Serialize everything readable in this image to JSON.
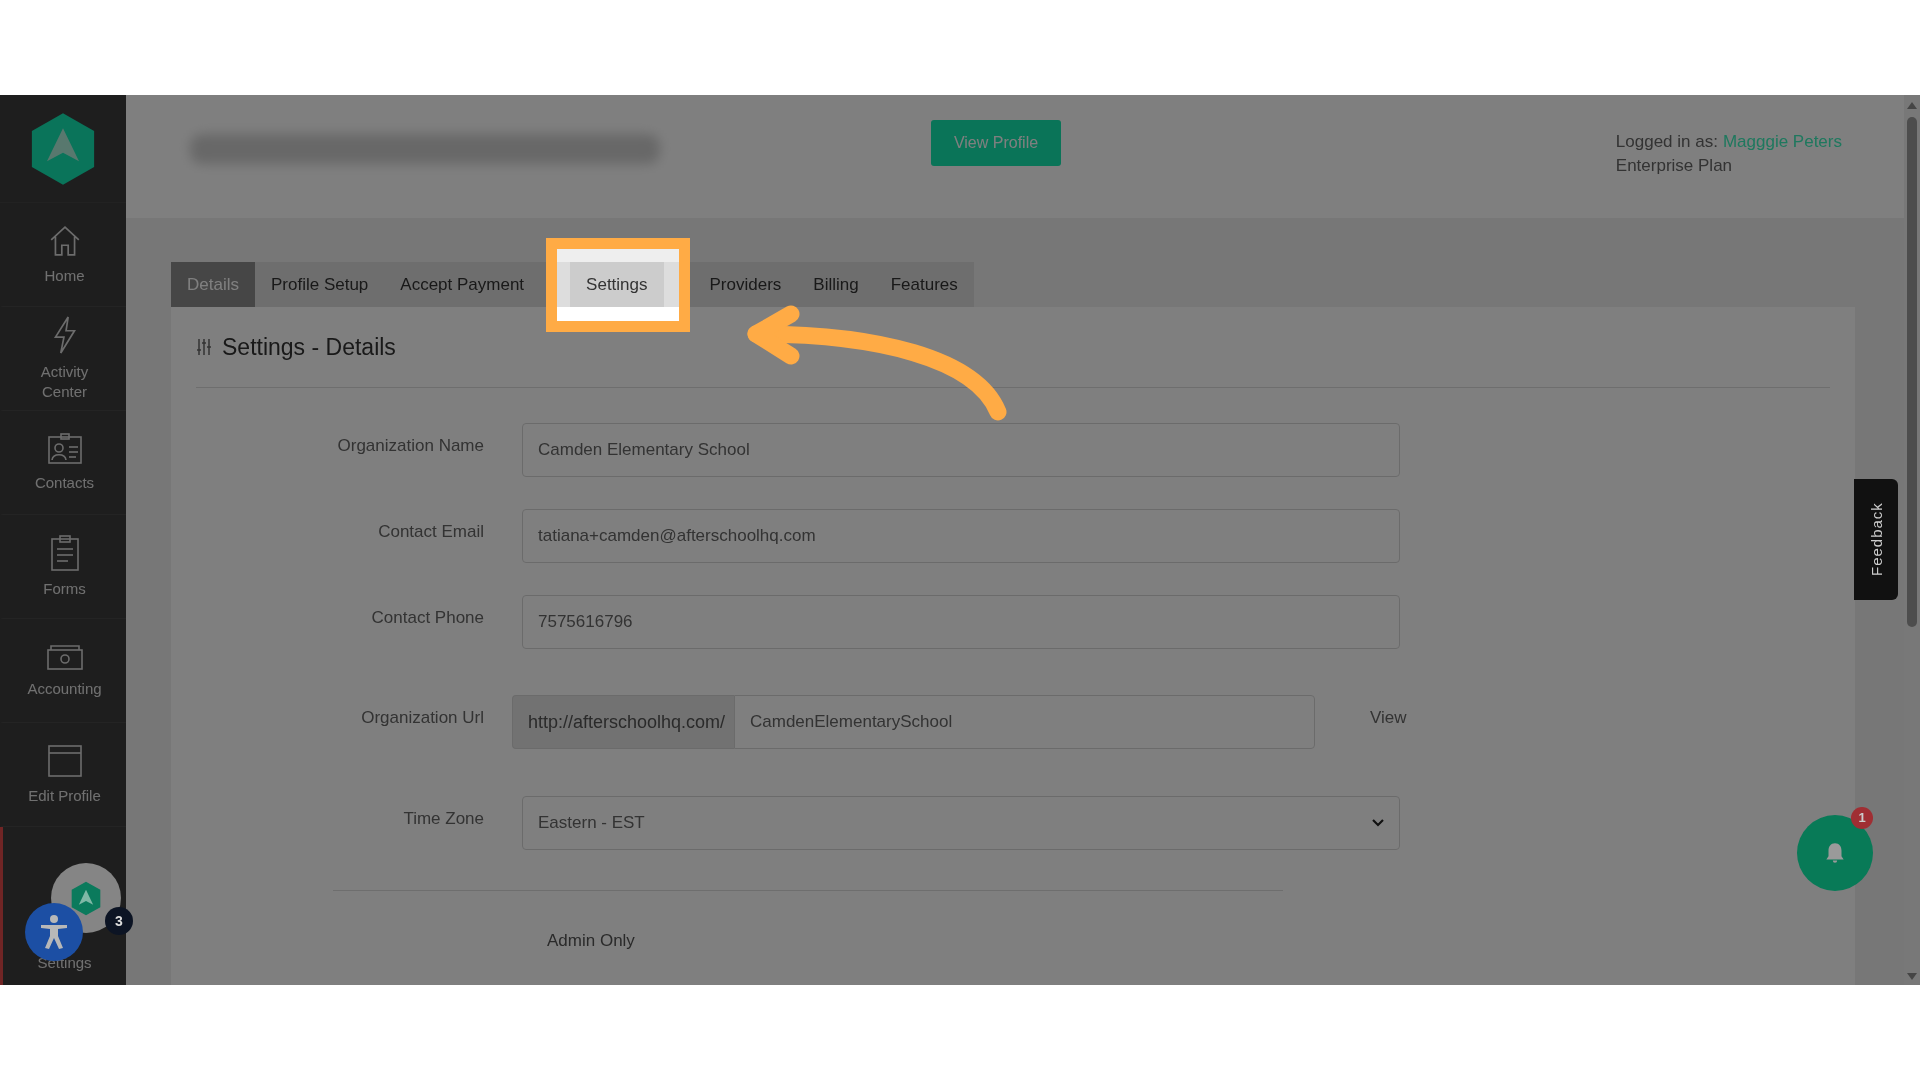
{
  "header": {
    "button": "View Profile",
    "logged_in_label": "Logged in as:",
    "user_name": "Magggie Peters",
    "plan": "Enterprise Plan"
  },
  "sidebar": {
    "items": [
      {
        "kind": "home",
        "label": "Home",
        "selected": false
      },
      {
        "kind": "bolt",
        "label": "Activity Center",
        "selected": false
      },
      {
        "kind": "contacts",
        "label": "Contacts",
        "selected": false
      },
      {
        "kind": "forms",
        "label": "Forms",
        "selected": false
      },
      {
        "kind": "accounting",
        "label": "Accounting",
        "selected": false
      },
      {
        "kind": "profile",
        "label": "Edit Profile",
        "selected": false
      },
      {
        "kind": "covered",
        "label": "Settings",
        "selected": true
      }
    ]
  },
  "tabs": [
    {
      "label": "Details",
      "selected": true,
      "highlighted": false
    },
    {
      "label": "Profile Setup",
      "selected": false,
      "highlighted": false
    },
    {
      "label": "Accept Payment",
      "selected": false,
      "highlighted": false
    },
    {
      "label": "Settings",
      "selected": false,
      "highlighted": true
    },
    {
      "label": "Providers",
      "selected": false,
      "highlighted": false
    },
    {
      "label": "Billing",
      "selected": false,
      "highlighted": false
    },
    {
      "label": "Features",
      "selected": false,
      "highlighted": false
    }
  ],
  "section": {
    "title": "Settings - Details"
  },
  "form": {
    "fields": [
      {
        "kind": "text",
        "label": "Organization Name",
        "value": "Camden Elementary School"
      },
      {
        "kind": "text",
        "label": "Contact Email",
        "value": "tatiana+camden@afterschoolhq.com"
      },
      {
        "kind": "text",
        "label": "Contact Phone",
        "value": "7575616796"
      },
      {
        "kind": "url",
        "label": "Organization Url",
        "prefix": "http://afterschoolhq.com/",
        "value": "CamdenElementarySchool",
        "link": "View"
      },
      {
        "kind": "select",
        "label": "Time Zone",
        "value": "Eastern - EST"
      }
    ],
    "subsection": "Admin Only"
  },
  "feedback_tab": "Feedback",
  "notifications": {
    "badge": "1"
  },
  "chat_widget": {
    "badge": "3"
  }
}
